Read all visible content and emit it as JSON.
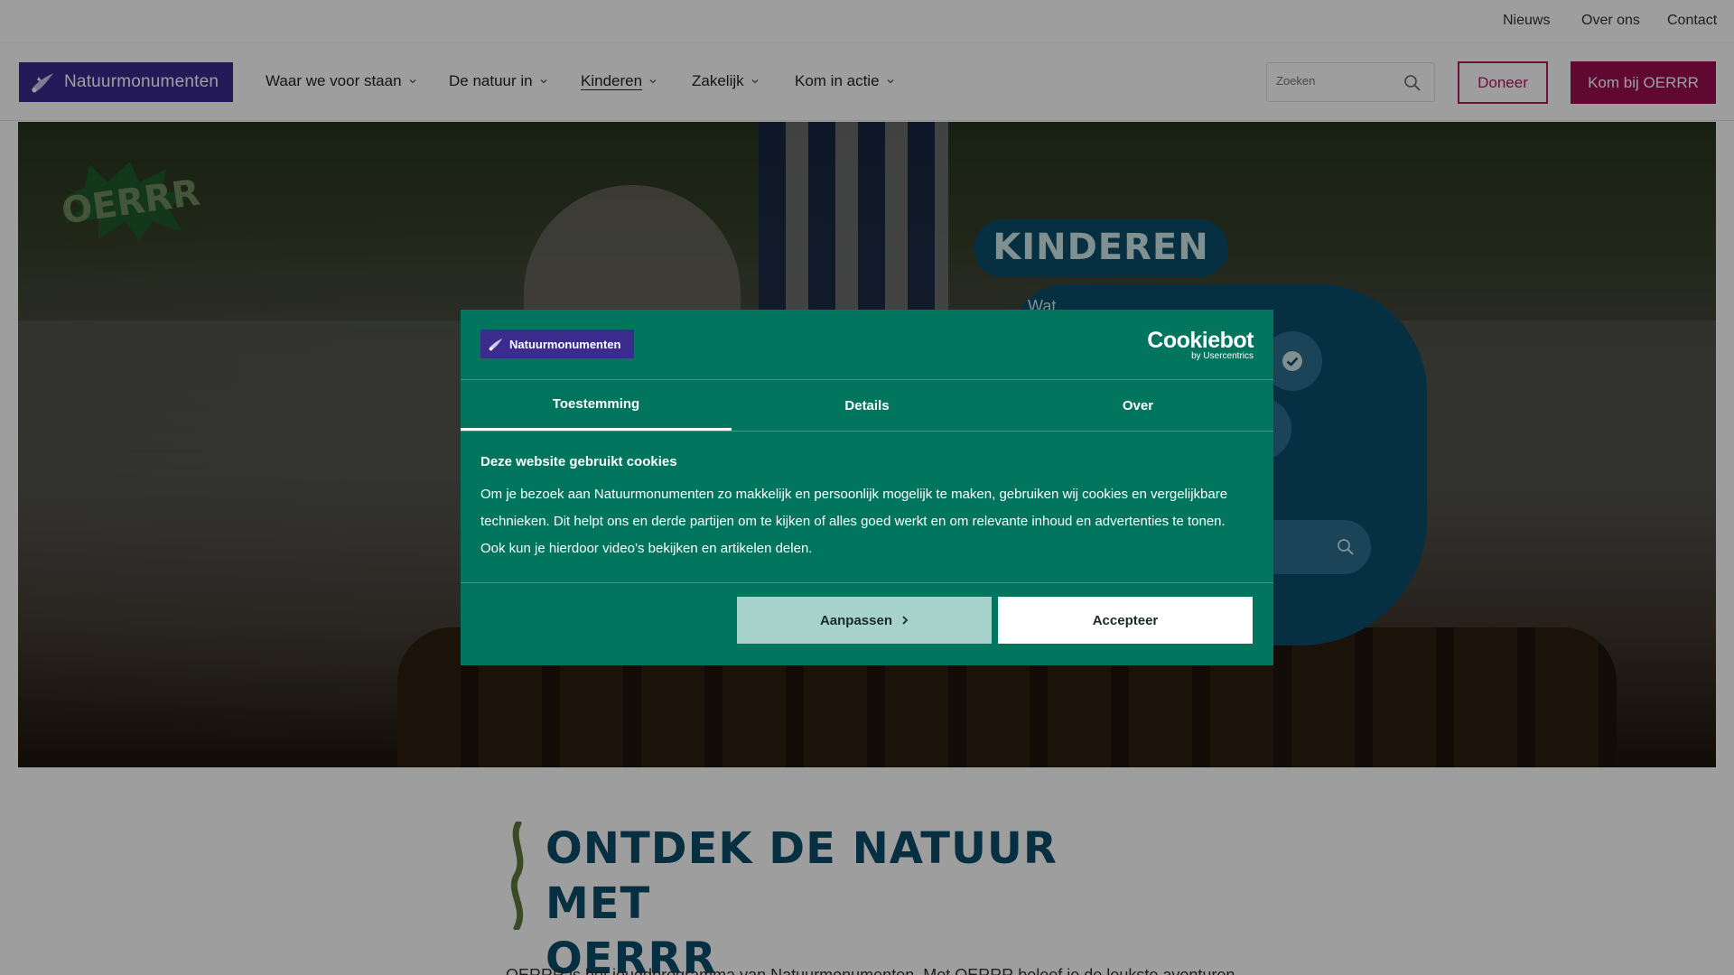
{
  "topbar": {
    "links": [
      "Nieuws",
      "Over ons",
      "Contact"
    ]
  },
  "brand": {
    "name": "Natuurmonumenten",
    "color": "#3b2b8d"
  },
  "nav": {
    "items": [
      "Waar we voor staan",
      "De natuur in",
      "Kinderen",
      "Zakelijk",
      "Kom in actie"
    ],
    "active": "Kinderen",
    "search_placeholder": "Zoeken",
    "donate_label": "Doneer",
    "join_label": "Kom bij OERRR"
  },
  "hero": {
    "badge": "OERRR",
    "title": "KINDEREN",
    "question_fragment": "Wat"
  },
  "section": {
    "title_line1": "ONTDEK DE NATUUR MET",
    "title_line2": "OERRR",
    "body_partial": "OERRR is het jeugdprogramma van Natuurmonumenten. Met OERRR beleef je de leukste avonturen"
  },
  "cookie_dialog": {
    "brand": "Natuurmonumenten",
    "provider": "Cookiebot",
    "provider_sub": "by Usercentrics",
    "tabs": [
      "Toestemming",
      "Details",
      "Over"
    ],
    "active_tab": "Toestemming",
    "heading": "Deze website gebruikt cookies",
    "text": "Om je bezoek aan Natuurmonumenten zo makkelijk en persoonlijk mogelijk te maken, gebruiken wij cookies en vergelijkbare technieken. Dit helpt ons en derde partijen om te kijken of alles goed werkt en om relevante inhoud en advertenties te tonen. Ook kun je hierdoor video’s bekijken en artikelen delen.",
    "customize_label": "Aanpassen",
    "accept_label": "Accepteer",
    "background_color": "#02755f"
  },
  "icons": [
    "logo-bird-icon",
    "chevron-down-icon",
    "search-icon",
    "checkmark-icon",
    "chevron-right-icon"
  ]
}
